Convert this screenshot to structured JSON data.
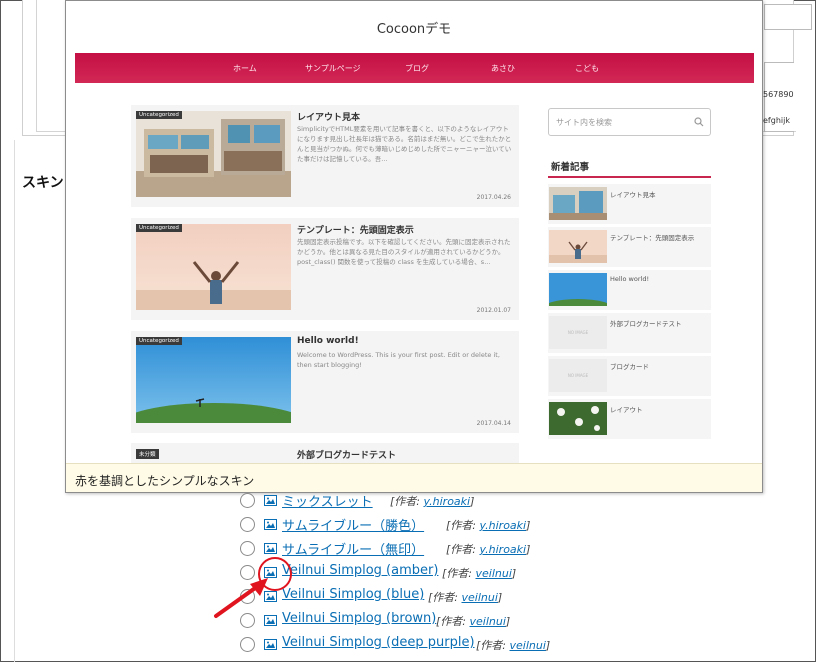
{
  "background": {
    "skin_heading": "スキン",
    "right_text_1": "567890",
    "right_text_2": "efghijk"
  },
  "preview": {
    "site_title": "Cocoonデモ",
    "nav": [
      "ホーム",
      "サンプルページ",
      "ブログ",
      "あさひ",
      "こども"
    ],
    "cards": [
      {
        "category": "Uncategorized",
        "title": "レイアウト見本",
        "excerpt": "SimplicityでHTML要素を用いて記事を書くと、以下のようなレイアウトになります見出し社長年は猫である。名前はまだ無い。どこで生れたかとんと見当がつかぬ。何でも薄暗いじめじめした所でニャーニャー泣いていた事だけは記憶している。吾...",
        "date": "2017.04.26"
      },
      {
        "category": "Uncategorized",
        "title": "テンプレート：先頭固定表示",
        "excerpt": "先頭固定表示投稿です。以下を確認してください。先頭に固定表示されたかどうか。他とは異なる見た目のスタイルが適用されているかどうか。post_class() 関数を使って投稿の class を生成している場合、s...",
        "date": "2012.01.07"
      },
      {
        "category": "Uncategorized",
        "title": "Hello world!",
        "excerpt": "Welcome to WordPress. This is your first post. Edit or delete it, then start blogging!",
        "date": "2017.04.14"
      },
      {
        "category": "未分類",
        "title": "外部ブログカードテスト",
        "excerpt": "",
        "date": ""
      }
    ],
    "search_placeholder": "サイト内を検索",
    "widget_title": "新着記事",
    "recent": [
      {
        "title": "レイアウト見本",
        "thumb": "shop"
      },
      {
        "title": "テンプレート：先頭固定表示",
        "thumb": "sunset"
      },
      {
        "title": "Hello world!",
        "thumb": "hill"
      },
      {
        "title": "外部ブログカードテスト",
        "thumb": "noimage"
      },
      {
        "title": "ブログカード",
        "thumb": "noimage"
      },
      {
        "title": "レイアウト",
        "thumb": "flowers"
      }
    ],
    "no_image_text": "NO IMAGE",
    "caption": "赤を基調としたシンプルなスキン"
  },
  "skins": [
    {
      "name": "ミックスレット",
      "author_label": "[作者: ",
      "author": "y.hiroaki",
      "close": "]"
    },
    {
      "name": "サムライブルー（勝色）",
      "author_label": "[作者: ",
      "author": "y.hiroaki",
      "close": "]"
    },
    {
      "name": "サムライブルー（無印）",
      "author_label": "[作者: ",
      "author": "y.hiroaki",
      "close": "]"
    },
    {
      "name": "Veilnui Simplog (amber)",
      "author_label": "[作者: ",
      "author": "veilnui",
      "close": "]"
    },
    {
      "name": "Veilnui Simplog (blue)",
      "author_label": "[作者: ",
      "author": "veilnui",
      "close": "]"
    },
    {
      "name": "Veilnui Simplog (brown)",
      "author_label": "[作者: ",
      "author": "veilnui",
      "close": "]"
    },
    {
      "name": "Veilnui Simplog (deep purple)",
      "author_label": "[作者: ",
      "author": "veilnui",
      "close": "]"
    }
  ],
  "colors": {
    "nav_red": "#c40f44",
    "link_blue": "#0a6eb4",
    "annotation_red": "#e0141e",
    "caption_bg": "#fffbe6"
  }
}
